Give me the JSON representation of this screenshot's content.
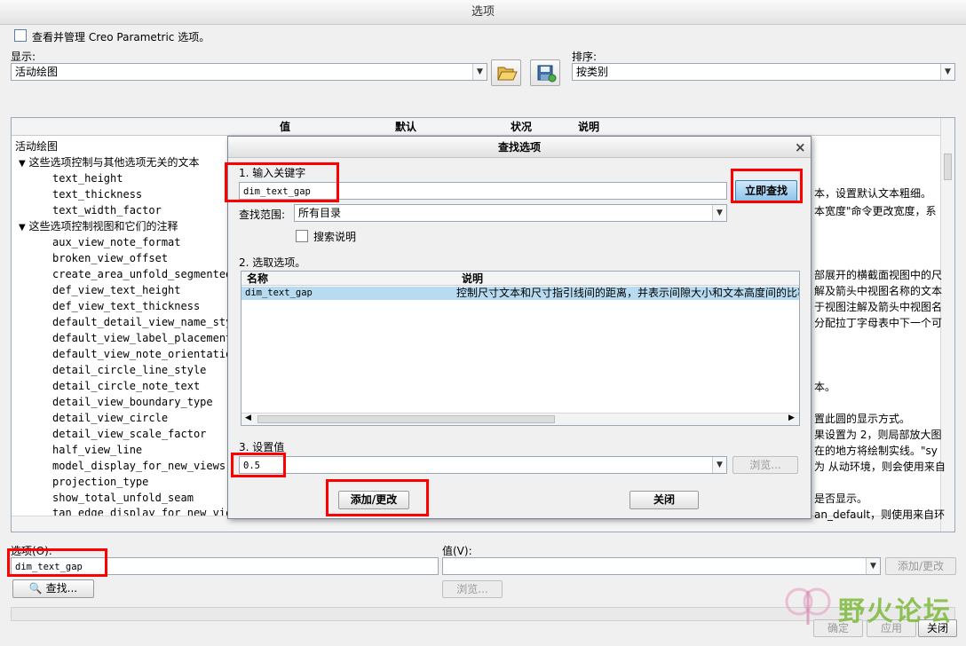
{
  "window": {
    "title": "选项"
  },
  "top": {
    "manage_label": "查看并管理 Creo Parametric 选项。",
    "display_label": "显示:",
    "display_value": "活动绘图",
    "sort_label": "排序:",
    "sort_value": "按类别",
    "open_icon": "folder-open-icon",
    "save_icon": "save-config-icon"
  },
  "grid": {
    "columns": [
      "值",
      "默认",
      "状况",
      "说明"
    ],
    "root": "活动绘图",
    "groups": [
      {
        "label": "这些选项控制与其他选项无关的文本",
        "items": [
          "text_height",
          "text_thickness",
          "text_width_factor"
        ]
      },
      {
        "label": "这些选项控制视图和它们的注释",
        "items": [
          "aux_view_note_format",
          "broken_view_offset",
          "create_area_unfold_segmented",
          "def_view_text_height",
          "def_view_text_thickness",
          "default_detail_view_name_style",
          "default_view_label_placement",
          "default_view_note_orientation",
          "detail_circle_line_style",
          "detail_circle_note_text",
          "detail_view_boundary_type",
          "detail_view_circle",
          "detail_view_scale_factor",
          "half_view_line",
          "model_display_for_new_views",
          "projection_type",
          "show_total_unfold_seam",
          "tan_edge_display_for_new_views"
        ]
      }
    ],
    "desc_fragments": [
      "本，设置默认文本粗细。",
      "本宽度\"命令更改宽度，系",
      "部展开的横截面视图中的尺",
      "解及箭头中视图名称的文本",
      "于视图注解及箭头中视图名",
      "分配拉丁字母表中下一个可",
      "本。",
      "置此圆的显示方式。",
      "果设置为 2，则局部放大图",
      "在的地方将绘制实线。\"sy",
      "为 从动环境，则会使用来自",
      "是否显示。",
      "an_default，则使用来自环"
    ]
  },
  "find_dialog": {
    "title": "查找选项",
    "close_glyph": "×",
    "step1_label": "1.  输入关键字",
    "keyword_value": "dim_text_gap",
    "find_now_button": "立即查找",
    "scope_label": "查找范围:",
    "scope_value": "所有目录",
    "search_desc_label": "搜索说明",
    "step2_label": "2.  选取选项。",
    "list_columns": [
      "名称",
      "说明"
    ],
    "result_name": "dim_text_gap",
    "result_desc": "控制尺寸文本和尺寸指引线间的距离，并表示间隙大小和文本高度间的比率",
    "step3_label": "3.  设置值",
    "value_value": "0.5",
    "browse_button": "浏览...",
    "add_change_button": "添加/更改",
    "close_button": "关闭"
  },
  "bottom": {
    "option_label": "选项(O):",
    "option_value": "dim_text_gap",
    "value_label": "值(V):",
    "value_value": "",
    "add_change_button": "添加/更改",
    "find_button": "查找...",
    "browse_button": "浏览...",
    "ok_button": "确定",
    "apply_button": "应用",
    "close_button": "关闭"
  },
  "watermark": {
    "text": "野火论坛"
  }
}
